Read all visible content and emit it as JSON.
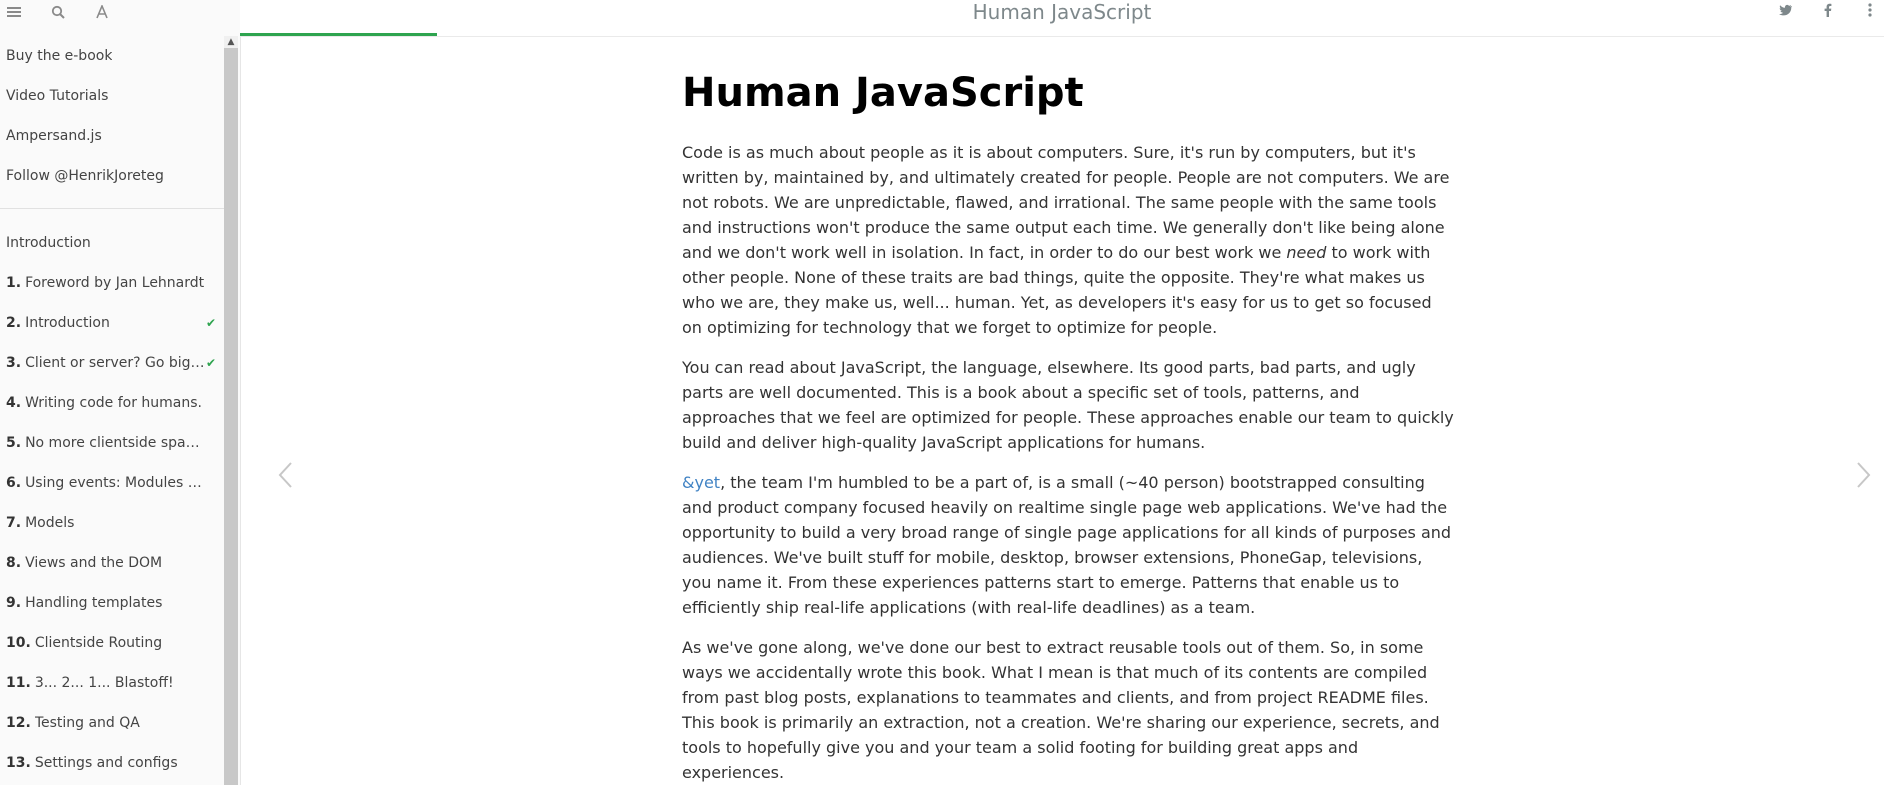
{
  "toolbar": {
    "menu_icon": "menu-icon",
    "search_icon": "search-icon",
    "font_icon": "font-settings-icon"
  },
  "header": {
    "title": "Human JavaScript",
    "reading_progress": 0.12,
    "social": [
      "twitter-icon",
      "facebook-icon",
      "share-icon"
    ]
  },
  "sidebar": {
    "links": [
      {
        "label": "Buy the e-book"
      },
      {
        "label": "Video Tutorials"
      },
      {
        "label": "Ampersand.js"
      },
      {
        "label": "Follow @HenrikJoreteg"
      }
    ],
    "chapters": [
      {
        "num": "",
        "label": "Introduction",
        "done": false
      },
      {
        "num": "1.",
        "label": "Foreword by Jan Lehnardt",
        "done": false
      },
      {
        "num": "2.",
        "label": "Introduction",
        "done": true
      },
      {
        "num": "3.",
        "label": "Client or server? Go big or ...",
        "done": true
      },
      {
        "num": "4.",
        "label": "Writing code for humans.",
        "done": false
      },
      {
        "num": "5.",
        "label": "No more clientside spaghe...",
        "done": false
      },
      {
        "num": "6.",
        "label": "Using events: Modules talk...",
        "done": false
      },
      {
        "num": "7.",
        "label": "Models",
        "done": false
      },
      {
        "num": "8.",
        "label": "Views and the DOM",
        "done": false
      },
      {
        "num": "9.",
        "label": "Handling templates",
        "done": false
      },
      {
        "num": "10.",
        "label": "Clientside Routing",
        "done": false
      },
      {
        "num": "11.",
        "label": "3... 2... 1... Blastoff!",
        "done": false
      },
      {
        "num": "12.",
        "label": "Testing and QA",
        "done": false
      },
      {
        "num": "13.",
        "label": "Settings and configs",
        "done": false
      }
    ]
  },
  "content": {
    "heading": "Human JavaScript",
    "p1_a": "Code is as much about people as it is about computers. Sure, it's run by computers, but it's written by, maintained by, and ultimately created for people. People are not computers. We are not robots. We are unpredictable, flawed, and irrational. The same people with the same tools and instructions won't produce the same output each time. We generally don't like being alone and we don't work well in isolation. In fact, in order to do our best work we ",
    "p1_em": "need",
    "p1_b": " to work with other people. None of these traits are bad things, quite the opposite. They're what makes us who we are, they make us, well... human. Yet, as developers it's easy for us to get so focused on optimizing for technology that we forget to optimize for people.",
    "p2": "You can read about JavaScript, the language, elsewhere. Its good parts, bad parts, and ugly parts are well documented. This is a book about a specific set of tools, patterns, and approaches that we feel are optimized for people. These approaches enable our team to quickly build and deliver high-quality JavaScript applications for humans.",
    "p3_link": "&yet",
    "p3_rest": ", the team I'm humbled to be a part of, is a small (~40 person) bootstrapped consulting and product company focused heavily on realtime single page web applications. We've had the opportunity to build a very broad range of single page applications for all kinds of purposes and audiences. We've built stuff for mobile, desktop, browser extensions, PhoneGap, televisions, you name it. From these experiences patterns start to emerge. Patterns that enable us to efficiently ship real-life applications (with real-life deadlines) as a team.",
    "p4": "As we've gone along, we've done our best to extract reusable tools out of them. So, in some ways we accidentally wrote this book. What I mean is that much of its contents are compiled from past blog posts, explanations to teammates and clients, and from project README files. This book is primarily an extraction, not a creation. We're sharing our experience, secrets, and tools to hopefully give you and your team a solid footing for building great apps and experiences."
  }
}
